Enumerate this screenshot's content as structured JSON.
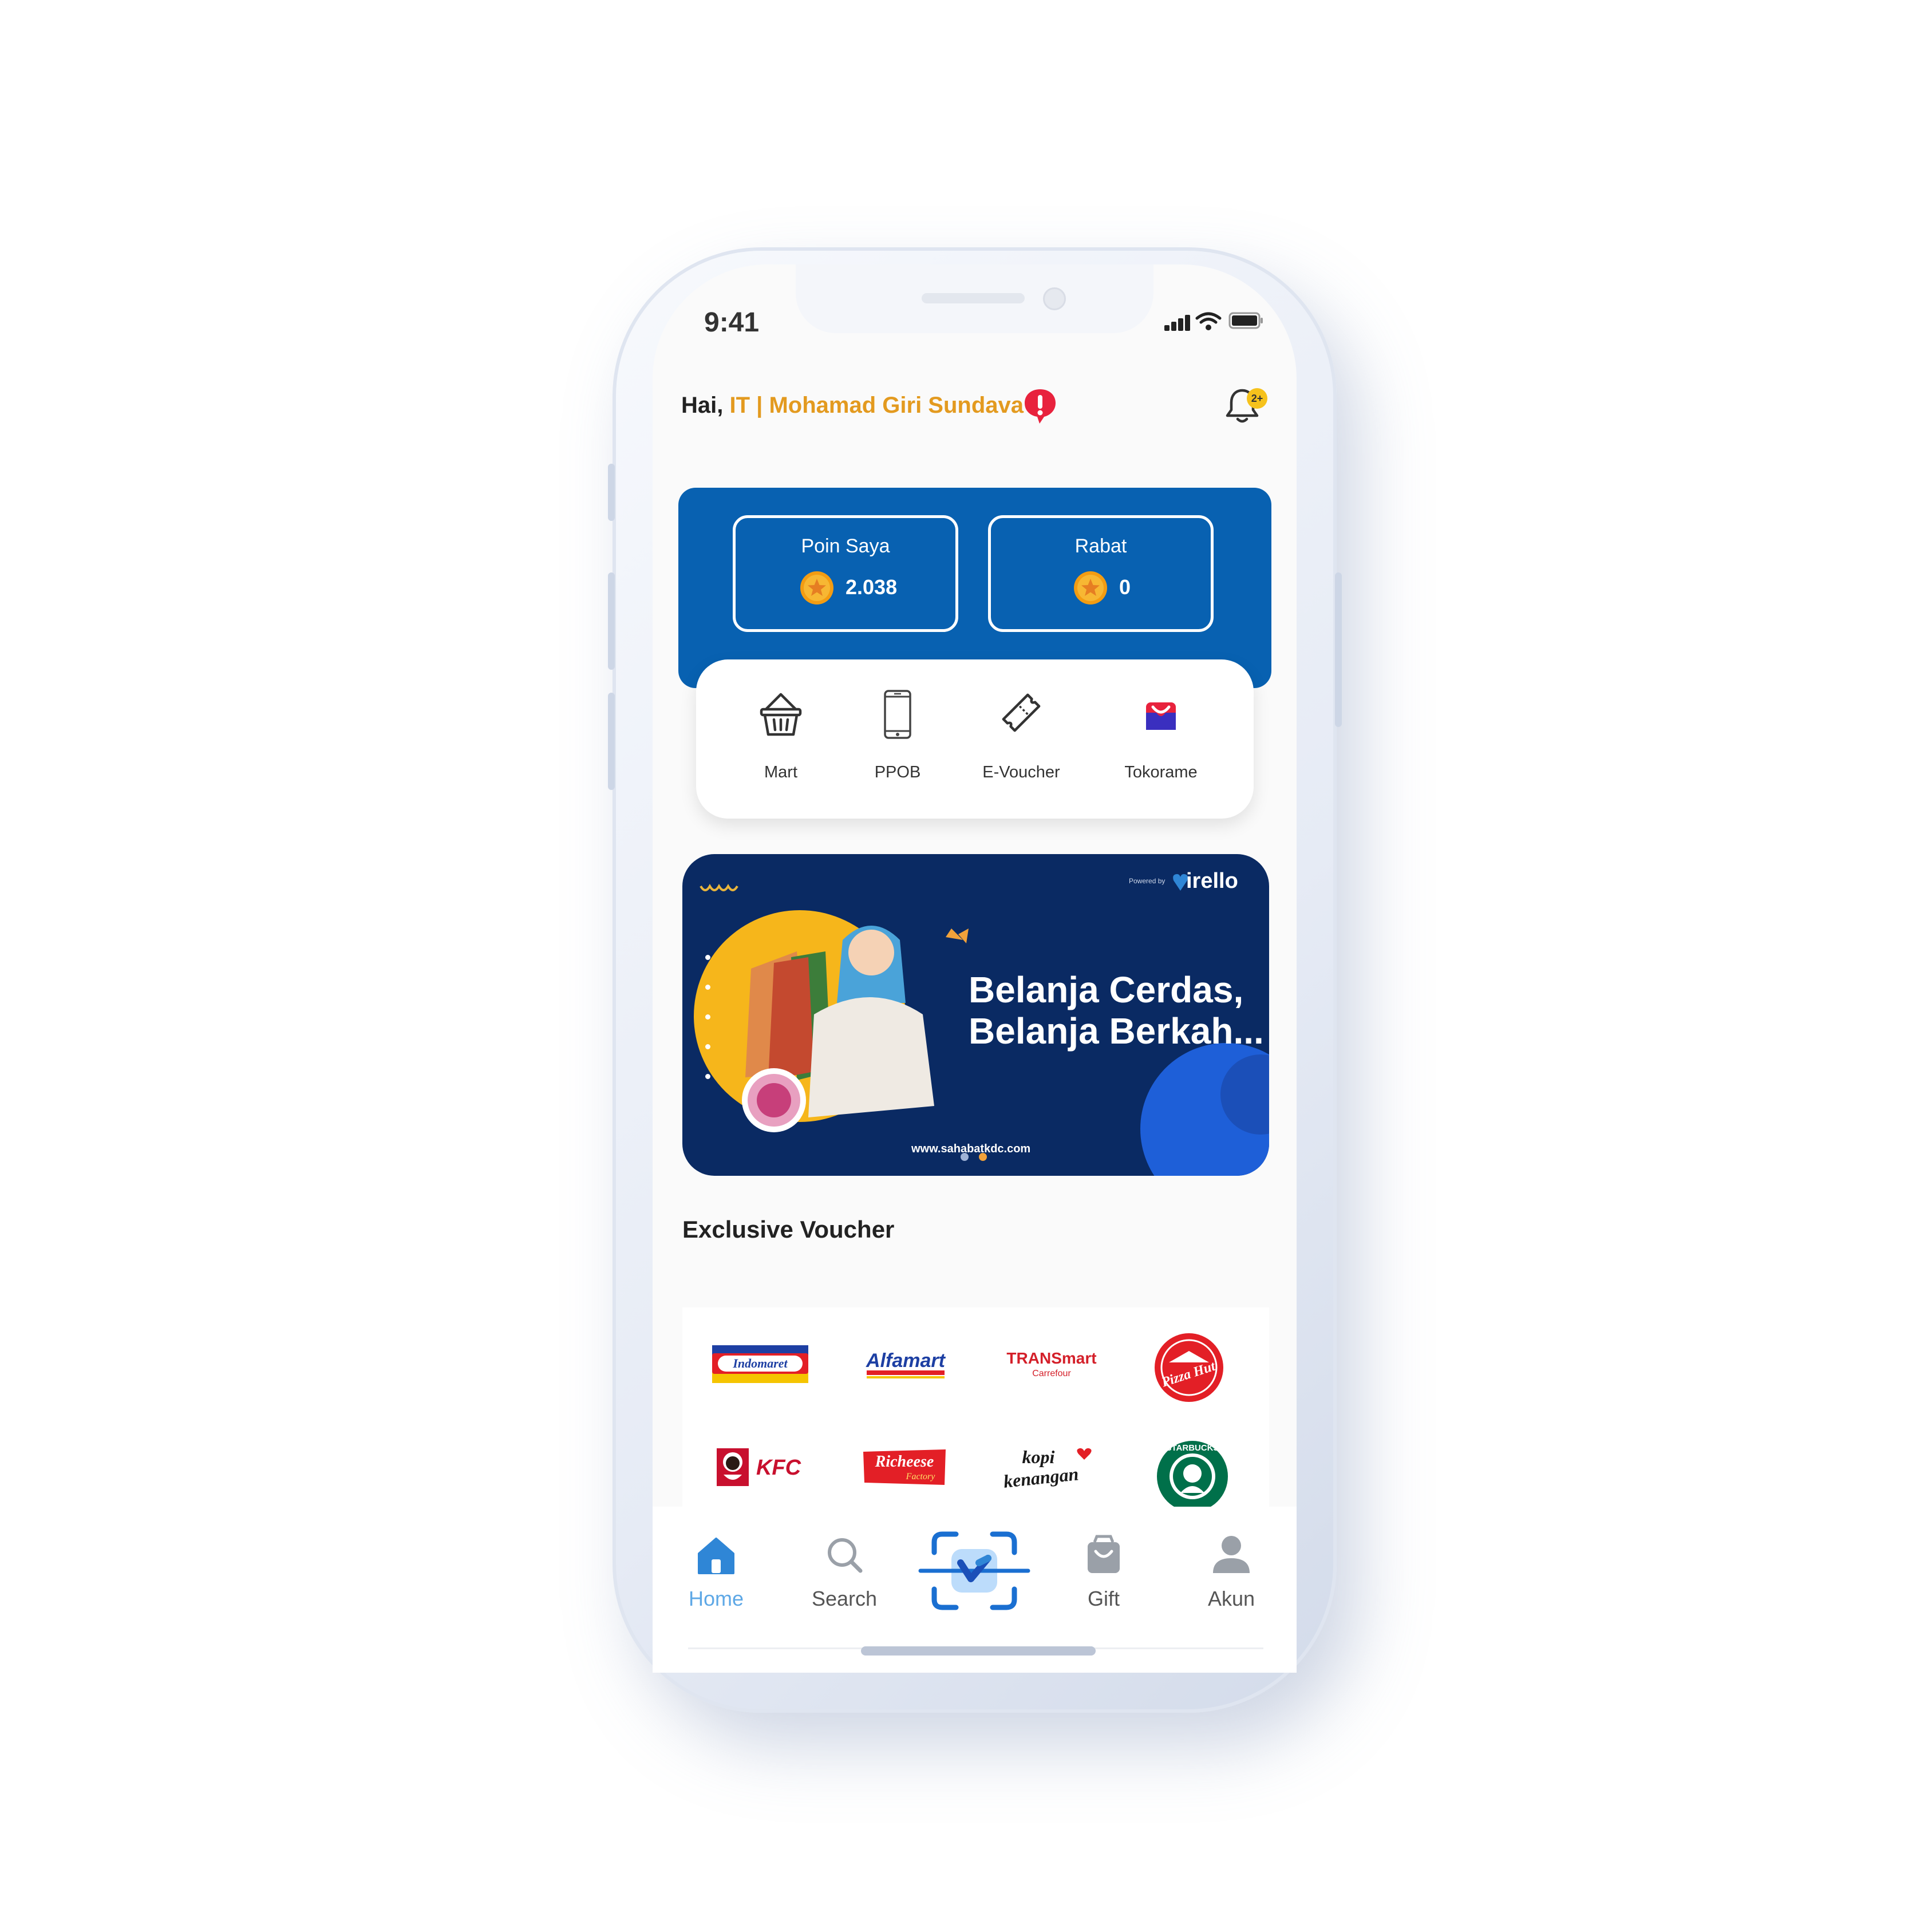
{
  "status_bar": {
    "time": "9:41"
  },
  "header": {
    "greeting": "Hai,",
    "division": "IT",
    "separator": "|",
    "user_name": "Mohamad Giri Sundava",
    "notification_badge": "2+"
  },
  "points": {
    "poin_saya": {
      "label": "Poin Saya",
      "value": "2.038"
    },
    "rabat": {
      "label": "Rabat",
      "value": "0"
    }
  },
  "menu": [
    {
      "label": "Mart",
      "icon": "basket-icon"
    },
    {
      "label": "PPOB",
      "icon": "phone-icon"
    },
    {
      "label": "E-Voucher",
      "icon": "ticket-icon"
    },
    {
      "label": "Tokorame",
      "icon": "tokorame-icon"
    }
  ],
  "banner": {
    "line1": "Belanja Cerdas,",
    "line2": "Belanja Berkah...",
    "url": "www.sahabatkdc.com",
    "powered_by": "Powered by",
    "brand": "irello",
    "slide_count": 2,
    "active_slide": 2
  },
  "section": {
    "title": "Exclusive Voucher"
  },
  "vouchers": [
    {
      "name": "Indomaret",
      "text": "Indomaret"
    },
    {
      "name": "Alfamart",
      "text": "Alfamart"
    },
    {
      "name": "Transmart",
      "text": "TRANSmart",
      "sub": "Carrefour"
    },
    {
      "name": "Pizza Hut",
      "text": "Pizza Hut"
    },
    {
      "name": "KFC",
      "text": "KFC"
    },
    {
      "name": "Richeese Factory",
      "text": "Richeese",
      "sub": "Factory"
    },
    {
      "name": "Kopi Kenangan",
      "text": "kopi",
      "sub": "kenangan"
    },
    {
      "name": "Starbucks",
      "text": "STARBUCKS"
    }
  ],
  "bottom_nav": [
    {
      "label": "Home",
      "active": true
    },
    {
      "label": "Search",
      "active": false
    },
    {
      "label": "",
      "active": false
    },
    {
      "label": "Gift",
      "active": false
    },
    {
      "label": "Akun",
      "active": false
    }
  ],
  "colors": {
    "primary_blue": "#0861b1",
    "accent_orange": "#e39a1f",
    "banner_navy": "#0a2a63",
    "active_nav": "#2f86d6"
  }
}
